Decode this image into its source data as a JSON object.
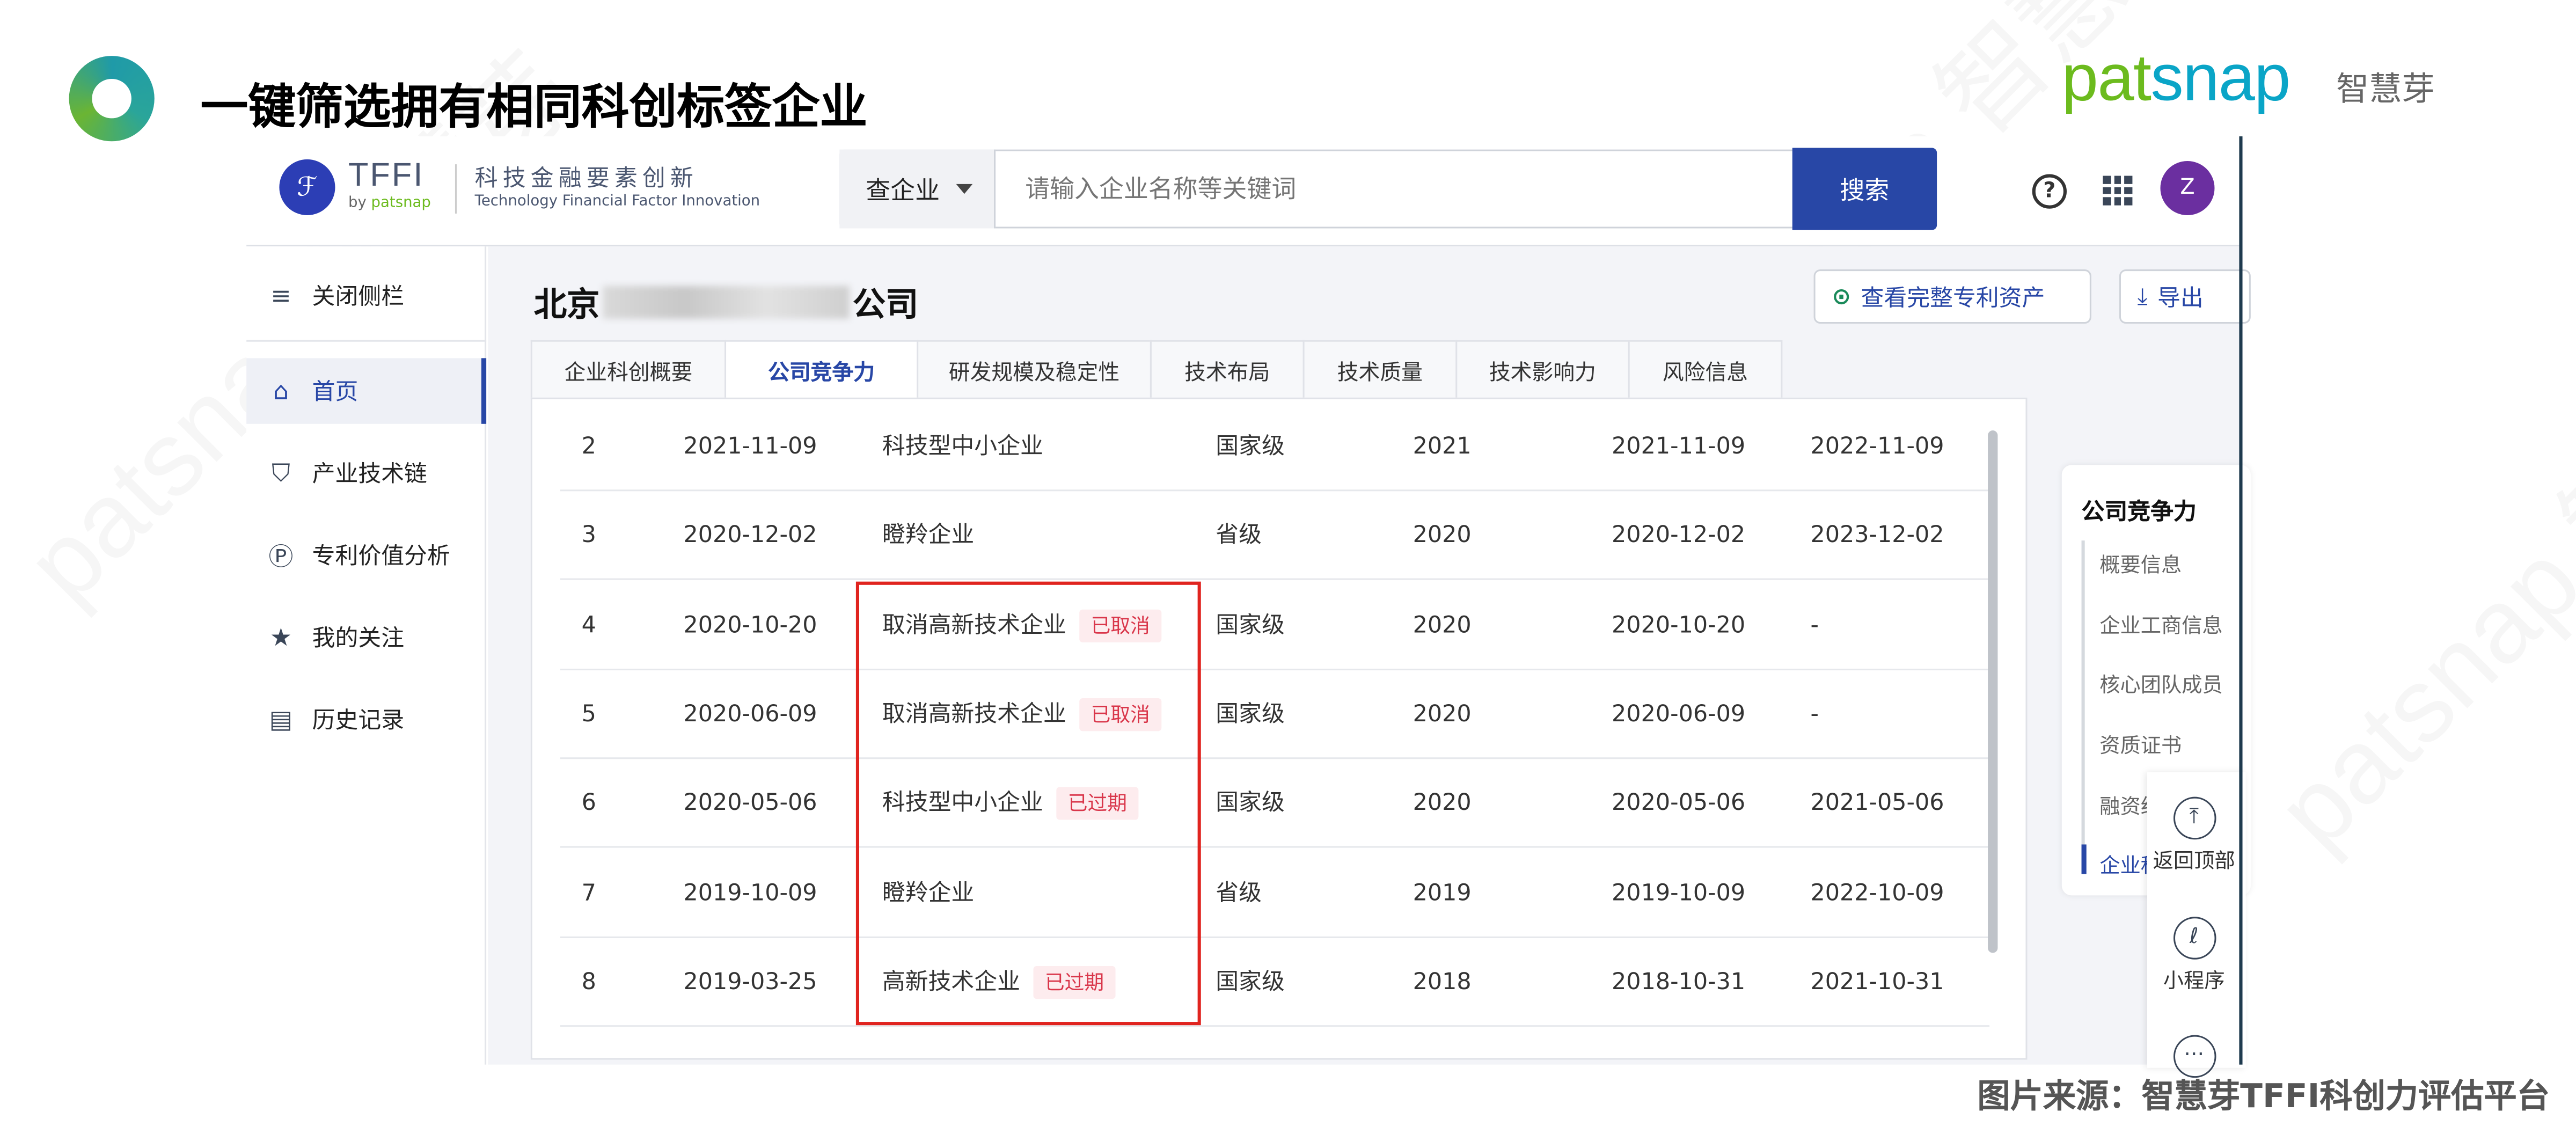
{
  "slide": {
    "title": "一键筛选拥有相同科创标签企业",
    "footer": "图片来源：智慧芽TFFI科创力评估平台",
    "brand_a": "pat",
    "brand_b": "snap",
    "brand_cn": "智慧芽",
    "watermark": "patsnap 智慧芽"
  },
  "app": {
    "logo": {
      "name": "TFFI",
      "by": "by ",
      "by_brand": "patsnap",
      "cn": "科技金融要素创新",
      "en": "Technology Financial Factor Innovation"
    },
    "search": {
      "scope": "查企业",
      "placeholder": "请输入企业名称等关键词",
      "button": "搜索"
    },
    "avatar": "Z",
    "help": "?",
    "sidebar": [
      {
        "label": "关闭侧栏",
        "icon": "≡"
      },
      {
        "label": "首页",
        "icon": "⌂"
      },
      {
        "label": "产业技术链",
        "icon": "⛉"
      },
      {
        "label": "专利价值分析",
        "icon": "Ⓟ"
      },
      {
        "label": "我的关注",
        "icon": "★"
      },
      {
        "label": "历史记录",
        "icon": "▤"
      }
    ],
    "company": {
      "prefix": "北京",
      "suffix": "公司"
    },
    "actions": {
      "patents": "查看完整专利资产",
      "export": "导出"
    },
    "tabs": [
      "企业科创概要",
      "公司竞争力",
      "研发规模及稳定性",
      "技术布局",
      "技术质量",
      "技术影响力",
      "风险信息"
    ],
    "rows": [
      {
        "no": "2",
        "date": "2021-11-09",
        "name": "科技型中小企业",
        "badge": "",
        "level": "国家级",
        "year": "2021",
        "start": "2021-11-09",
        "end": "2022-11-09"
      },
      {
        "no": "3",
        "date": "2020-12-02",
        "name": "瞪羚企业",
        "badge": "",
        "level": "省级",
        "year": "2020",
        "start": "2020-12-02",
        "end": "2023-12-02"
      },
      {
        "no": "4",
        "date": "2020-10-20",
        "name": "取消高新技术企业",
        "badge": "已取消",
        "level": "国家级",
        "year": "2020",
        "start": "2020-10-20",
        "end": "-"
      },
      {
        "no": "5",
        "date": "2020-06-09",
        "name": "取消高新技术企业",
        "badge": "已取消",
        "level": "国家级",
        "year": "2020",
        "start": "2020-06-09",
        "end": "-"
      },
      {
        "no": "6",
        "date": "2020-05-06",
        "name": "科技型中小企业",
        "badge": "已过期",
        "level": "国家级",
        "year": "2020",
        "start": "2020-05-06",
        "end": "2021-05-06"
      },
      {
        "no": "7",
        "date": "2019-10-09",
        "name": "瞪羚企业",
        "badge": "",
        "level": "省级",
        "year": "2019",
        "start": "2019-10-09",
        "end": "2022-10-09"
      },
      {
        "no": "8",
        "date": "2019-03-25",
        "name": "高新技术企业",
        "badge": "已过期",
        "level": "国家级",
        "year": "2018",
        "start": "2018-10-31",
        "end": "2021-10-31"
      }
    ],
    "toc": {
      "title": "公司竞争力",
      "items": [
        "概要信息",
        "企业工商信息",
        "核心团队成员",
        "资质证书",
        "融资经",
        "企业科"
      ]
    },
    "float": {
      "top": "返回顶部",
      "mini": "小程序"
    }
  }
}
